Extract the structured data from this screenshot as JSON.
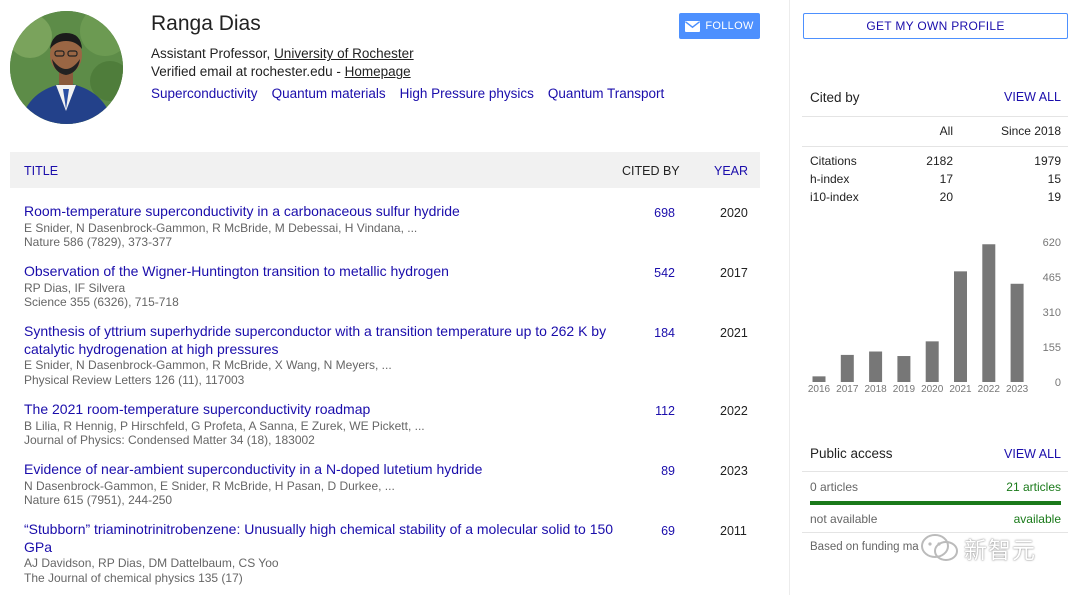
{
  "profile": {
    "name": "Ranga Dias",
    "title_prefix": "Assistant Professor, ",
    "affiliation": "University of Rochester",
    "email_text": "Verified email at rochester.edu - ",
    "homepage": "Homepage",
    "interests": [
      "Superconductivity",
      "Quantum materials",
      "High Pressure physics",
      "Quantum Transport"
    ],
    "follow_label": "FOLLOW"
  },
  "table": {
    "headers": {
      "title": "TITLE",
      "cited_by": "CITED BY",
      "year": "YEAR"
    },
    "rows": [
      {
        "title": "Room-temperature superconductivity in a carbonaceous sulfur hydride",
        "authors": "E Snider, N Dasenbrock-Gammon, R McBride, M Debessai, H Vindana, ...",
        "venue": "Nature 586 (7829), 373-377",
        "cited": "698",
        "year": "2020"
      },
      {
        "title": "Observation of the Wigner-Huntington transition to metallic hydrogen",
        "authors": "RP Dias, IF Silvera",
        "venue": "Science 355 (6326), 715-718",
        "cited": "542",
        "year": "2017"
      },
      {
        "title": "Synthesis of yttrium superhydride superconductor with a transition temperature up to 262 K by catalytic hydrogenation at high pressures",
        "authors": "E Snider, N Dasenbrock-Gammon, R McBride, X Wang, N Meyers, ...",
        "venue": "Physical Review Letters 126 (11), 117003",
        "cited": "184",
        "year": "2021"
      },
      {
        "title": "The 2021 room-temperature superconductivity roadmap",
        "authors": "B Lilia, R Hennig, P Hirschfeld, G Profeta, A Sanna, E Zurek, WE Pickett, ...",
        "venue": "Journal of Physics: Condensed Matter 34 (18), 183002",
        "cited": "112",
        "year": "2022"
      },
      {
        "title": "Evidence of near-ambient superconductivity in a N-doped lutetium hydride",
        "authors": "N Dasenbrock-Gammon, E Snider, R McBride, H Pasan, D Durkee, ...",
        "venue": "Nature 615 (7951), 244-250",
        "cited": "89",
        "year": "2023"
      },
      {
        "title": "“Stubborn” triaminotrinitrobenzene: Unusually high chemical stability of a molecular solid to 150 GPa",
        "authors": "AJ Davidson, RP Dias, DM Dattelbaum, CS Yoo",
        "venue": "The Journal of chemical physics 135 (17)",
        "cited": "69",
        "year": "2011"
      }
    ]
  },
  "sidebar": {
    "get_profile_label": "GET MY OWN PROFILE",
    "cited_by": {
      "title": "Cited by",
      "view_all": "VIEW ALL",
      "col_all": "All",
      "col_since": "Since 2018",
      "rows": [
        {
          "label": "Citations",
          "all": "2182",
          "since": "1979"
        },
        {
          "label": "h-index",
          "all": "17",
          "since": "15"
        },
        {
          "label": "i10-index",
          "all": "20",
          "since": "19"
        }
      ]
    },
    "public_access": {
      "title": "Public access",
      "view_all": "VIEW ALL",
      "left_count": "0 articles",
      "right_count": "21 articles",
      "left_status": "not available",
      "right_status": "available",
      "funding": "Based on funding ma"
    }
  },
  "chart_data": {
    "type": "bar",
    "categories": [
      "2016",
      "2017",
      "2018",
      "2019",
      "2020",
      "2021",
      "2022",
      "2023"
    ],
    "values": [
      25,
      120,
      135,
      115,
      180,
      490,
      610,
      435
    ],
    "yticks": [
      "620",
      "465",
      "310",
      "155",
      "0"
    ],
    "ylim": [
      0,
      620
    ],
    "bar_color": "#777777"
  },
  "watermark": {
    "text": "新智元"
  },
  "colors": {
    "link": "#1a0dab",
    "accent": "#4d90fe",
    "available": "#1a7a1a"
  }
}
